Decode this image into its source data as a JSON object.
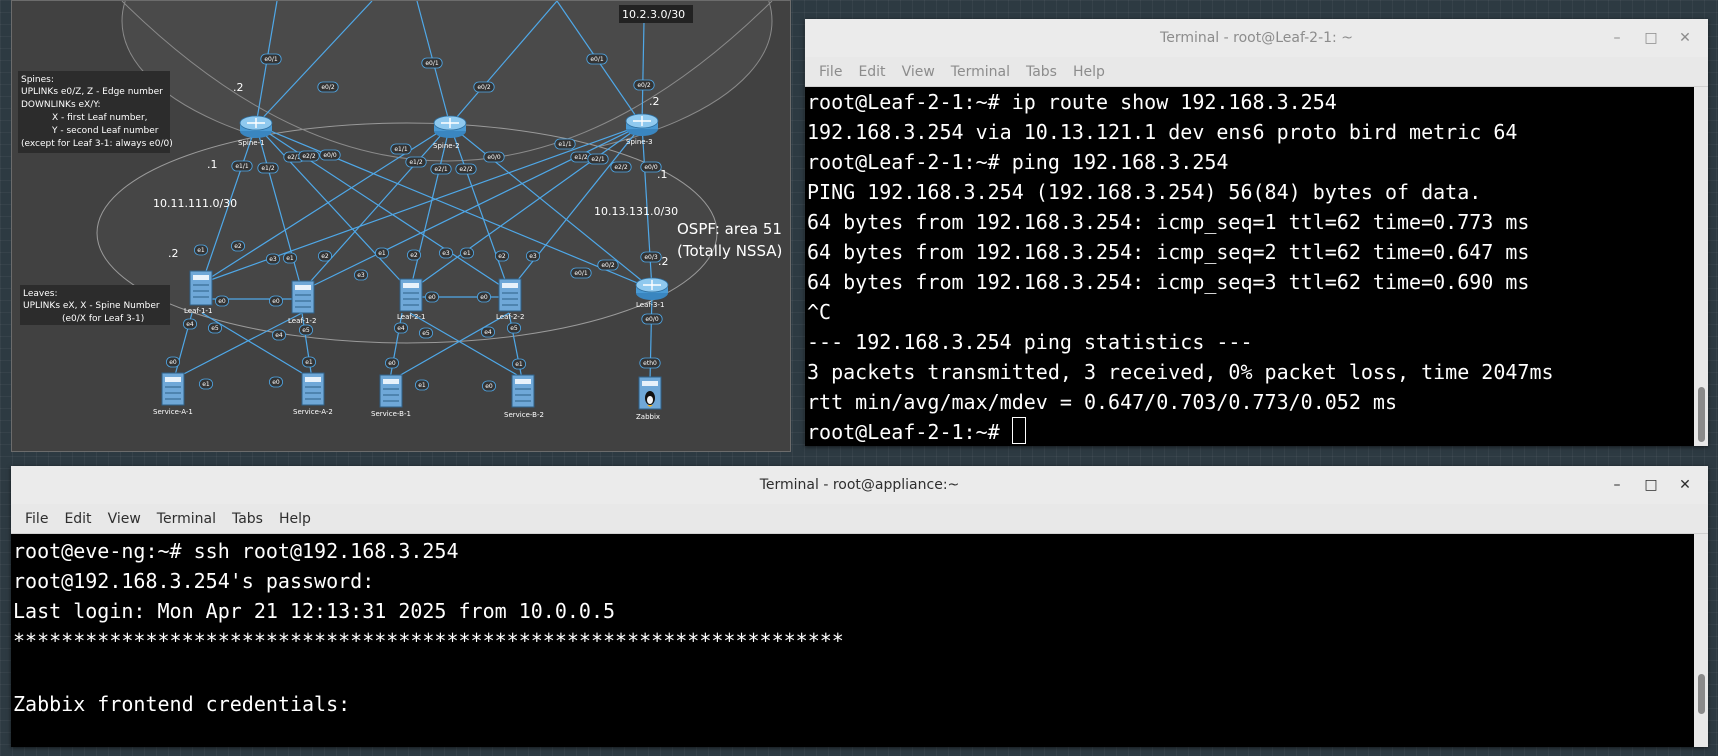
{
  "topology": {
    "nodes": {
      "spine1": "Spine-1",
      "spine2": "Spine-2",
      "spine3": "Spine-3",
      "leaf11": "Leaf-1-1",
      "leaf12": "Leaf-1-2",
      "leaf21": "Leaf-2-1",
      "leaf22": "Leaf-2-2",
      "leaf31": "Leaf-3-1",
      "svca1": "Service-A-1",
      "svca2": "Service-A-2",
      "svcb1": "Service-B-1",
      "svcb2": "Service-B-2",
      "zabbix": "Zabbix"
    },
    "networks": {
      "net_top": "10.2.3.0/30",
      "net_left": "10.11.111.0/30",
      "net_right": "10.13.131.0/30"
    },
    "addresses": {
      "a1": ".2",
      "a2": ".2",
      "a3": ".1",
      "a4": ".2",
      "a5": ".1",
      "a6": ".2"
    },
    "ospf_note": [
      "OSPF: area 51",
      "(Totally NSSA)"
    ],
    "spines_note": [
      "Spines:",
      "UPLINKs e0/Z, Z - Edge number",
      "DOWNLINKs eX/Y:",
      "X - first Leaf number,",
      "Y - second Leaf number",
      "(except for Leaf 3-1: always e0/0)"
    ],
    "leaves_note": [
      "Leaves:",
      "UPLINKs eX, X - Spine Number",
      "(e0/X for Leaf 3-1)"
    ],
    "interfaces": {
      "i1": "e0/1",
      "i2": "e0/1",
      "i3": "e0/1",
      "i4": "e0/2",
      "i5": "e0/2",
      "i6": "e0/2",
      "i7": "e1/1",
      "i8": "e1/2",
      "i9": "e2/1",
      "i10": "e2/2",
      "i11": "e0/0",
      "i12": "e1/1",
      "i13": "e1/2",
      "i14": "e2/1",
      "i15": "e2/2",
      "i16": "e0/0",
      "i17": "e1/1",
      "i18": "e1/2",
      "i19": "e2/1",
      "i20": "e2/2",
      "i21": "e0/0",
      "i22": "e1",
      "i23": "e2",
      "i24": "e3",
      "i25": "e1",
      "i26": "e2",
      "i27": "e3",
      "i28": "e1",
      "i29": "e2",
      "i30": "e3",
      "i31": "e1",
      "i32": "e2",
      "i33": "e3",
      "i34": "e0/1",
      "i35": "e0/2",
      "i36": "e0/3",
      "i37": "e0/0",
      "i38": "eth0",
      "i39": "e0",
      "i40": "e0",
      "i41": "e0",
      "i42": "e0",
      "i43": "e4",
      "i44": "e5",
      "i45": "e4",
      "i46": "e5",
      "i47": "e4",
      "i48": "e5",
      "i49": "e4",
      "i50": "e5",
      "i51": "e0",
      "i52": "e1",
      "i53": "e0",
      "i54": "e1",
      "i55": "e0",
      "i56": "e1",
      "i57": "e0",
      "i58": "e1"
    }
  },
  "terminal_top": {
    "title": "Terminal - root@Leaf-2-1: ~",
    "menu": [
      "File",
      "Edit",
      "View",
      "Terminal",
      "Tabs",
      "Help"
    ],
    "lines": [
      "root@Leaf-2-1:~# ip route show 192.168.3.254",
      "192.168.3.254 via 10.13.121.1 dev ens6 proto bird metric 64",
      "root@Leaf-2-1:~# ping 192.168.3.254",
      "PING 192.168.3.254 (192.168.3.254) 56(84) bytes of data.",
      "64 bytes from 192.168.3.254: icmp_seq=1 ttl=62 time=0.773 ms",
      "64 bytes from 192.168.3.254: icmp_seq=2 ttl=62 time=0.647 ms",
      "64 bytes from 192.168.3.254: icmp_seq=3 ttl=62 time=0.690 ms",
      "^C",
      "--- 192.168.3.254 ping statistics ---",
      "3 packets transmitted, 3 received, 0% packet loss, time 2047ms",
      "rtt min/avg/max/mdev = 0.647/0.703/0.773/0.052 ms",
      "root@Leaf-2-1:~# "
    ]
  },
  "terminal_bottom": {
    "title": "Terminal - root@appliance:~",
    "menu": [
      "File",
      "Edit",
      "View",
      "Terminal",
      "Tabs",
      "Help"
    ],
    "lines": [
      "root@eve-ng:~# ssh root@192.168.3.254",
      "root@192.168.3.254's password:",
      "Last login: Mon Apr 21 12:13:31 2025 from 10.0.0.5",
      "*********************************************************************",
      "",
      "Zabbix frontend credentials:"
    ]
  },
  "window_controls": {
    "minimize": "–",
    "maximize": "□",
    "close": "✕"
  },
  "colors": {
    "link": "#4fa8e8",
    "canvas": "#414141",
    "titlebar": "#ebebeb"
  }
}
